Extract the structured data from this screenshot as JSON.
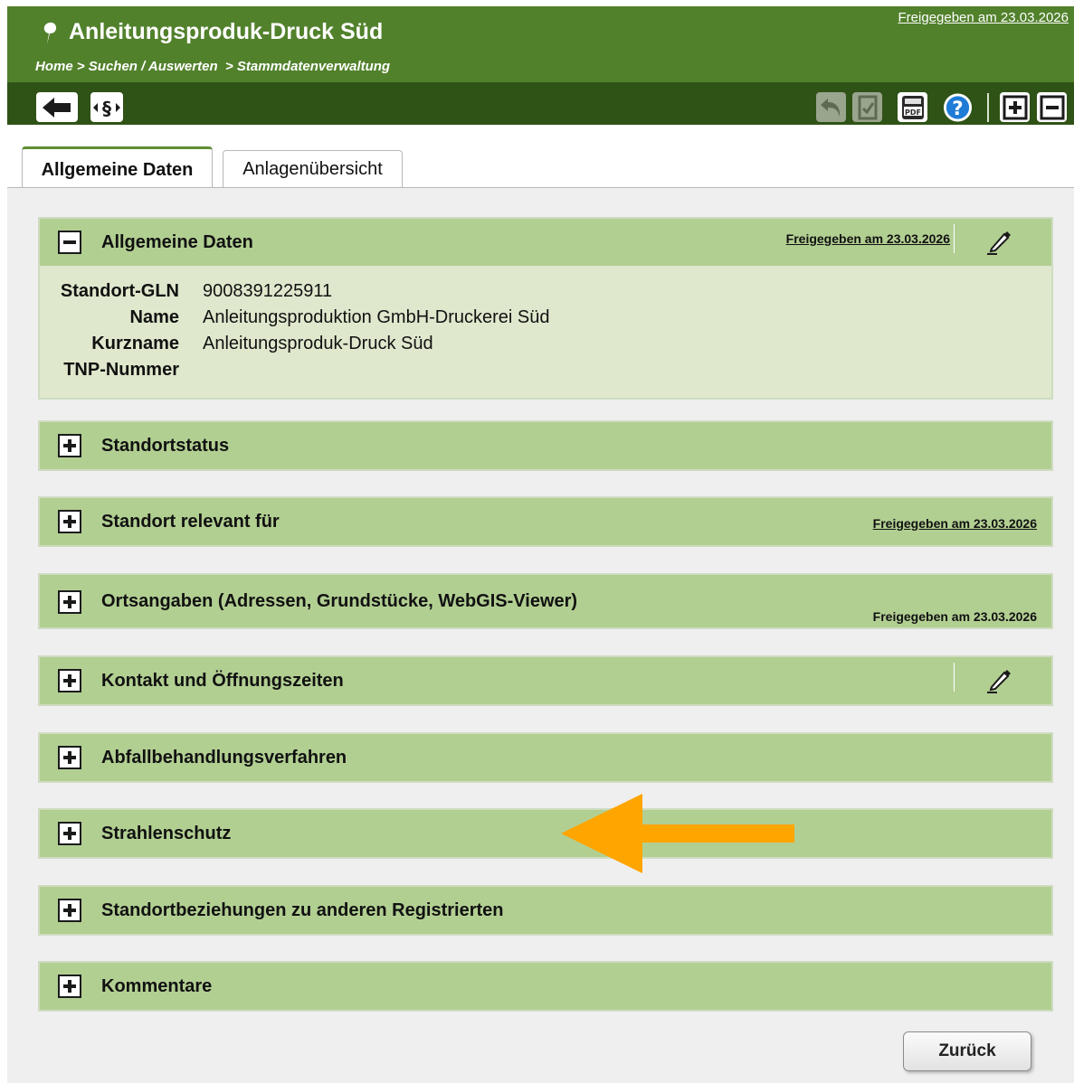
{
  "header": {
    "title": "Anleitungsproduk-Druck Süd",
    "release_link": "Freigegeben am 23.03.2026",
    "breadcrumb": {
      "home": "Home",
      "sep1": ">",
      "search": "Suchen / Auswerten",
      "sep2": ">",
      "current": "Stammdatenverwaltung"
    }
  },
  "toolbar": {
    "left_icons": [
      "back-arrow-icon",
      "paragraph-icon"
    ],
    "right_icons": [
      "undo-icon",
      "document-check-icon",
      "pdf-icon",
      "help-icon",
      "expand-all-icon",
      "collapse-all-icon"
    ]
  },
  "tabs": [
    {
      "label": "Allgemeine Daten",
      "active": true
    },
    {
      "label": "Anlagenübersicht",
      "active": false
    }
  ],
  "panels": {
    "allgemeine": {
      "title": "Allgemeine Daten",
      "release": "Freigegeben am 23.03.2026",
      "fields": [
        {
          "label": "Standort-GLN",
          "value": "9008391225911"
        },
        {
          "label": "Name",
          "value": "Anleitungsproduktion GmbH-Druckerei Süd"
        },
        {
          "label": "Kurzname",
          "value": "Anleitungsproduk-Druck Süd"
        },
        {
          "label": "TNP-Nummer",
          "value": ""
        }
      ]
    },
    "standortstatus": {
      "title": "Standortstatus"
    },
    "relevant": {
      "title": "Standort relevant für",
      "release": "Freigegeben am 23.03.2026"
    },
    "ortsangaben": {
      "title": "Ortsangaben (Adressen, Grundstücke, WebGIS-Viewer)",
      "release": "Freigegeben am 23.03.2026"
    },
    "kontakt": {
      "title": "Kontakt und Öffnungszeiten"
    },
    "abfall": {
      "title": "Abfallbehandlungsverfahren"
    },
    "strahlenschutz": {
      "title": "Strahlenschutz"
    },
    "beziehungen": {
      "title": "Standortbeziehungen zu anderen Registrierten"
    },
    "kommentare": {
      "title": "Kommentare"
    }
  },
  "buttons": {
    "back": "Zurück"
  },
  "colors": {
    "header_green": "#52812c",
    "toolbar_dark_green": "#2f5316",
    "panel_green": "#b2cf92",
    "panel_body": "#dfe8cd",
    "annotation_arrow": "#ffa500"
  }
}
